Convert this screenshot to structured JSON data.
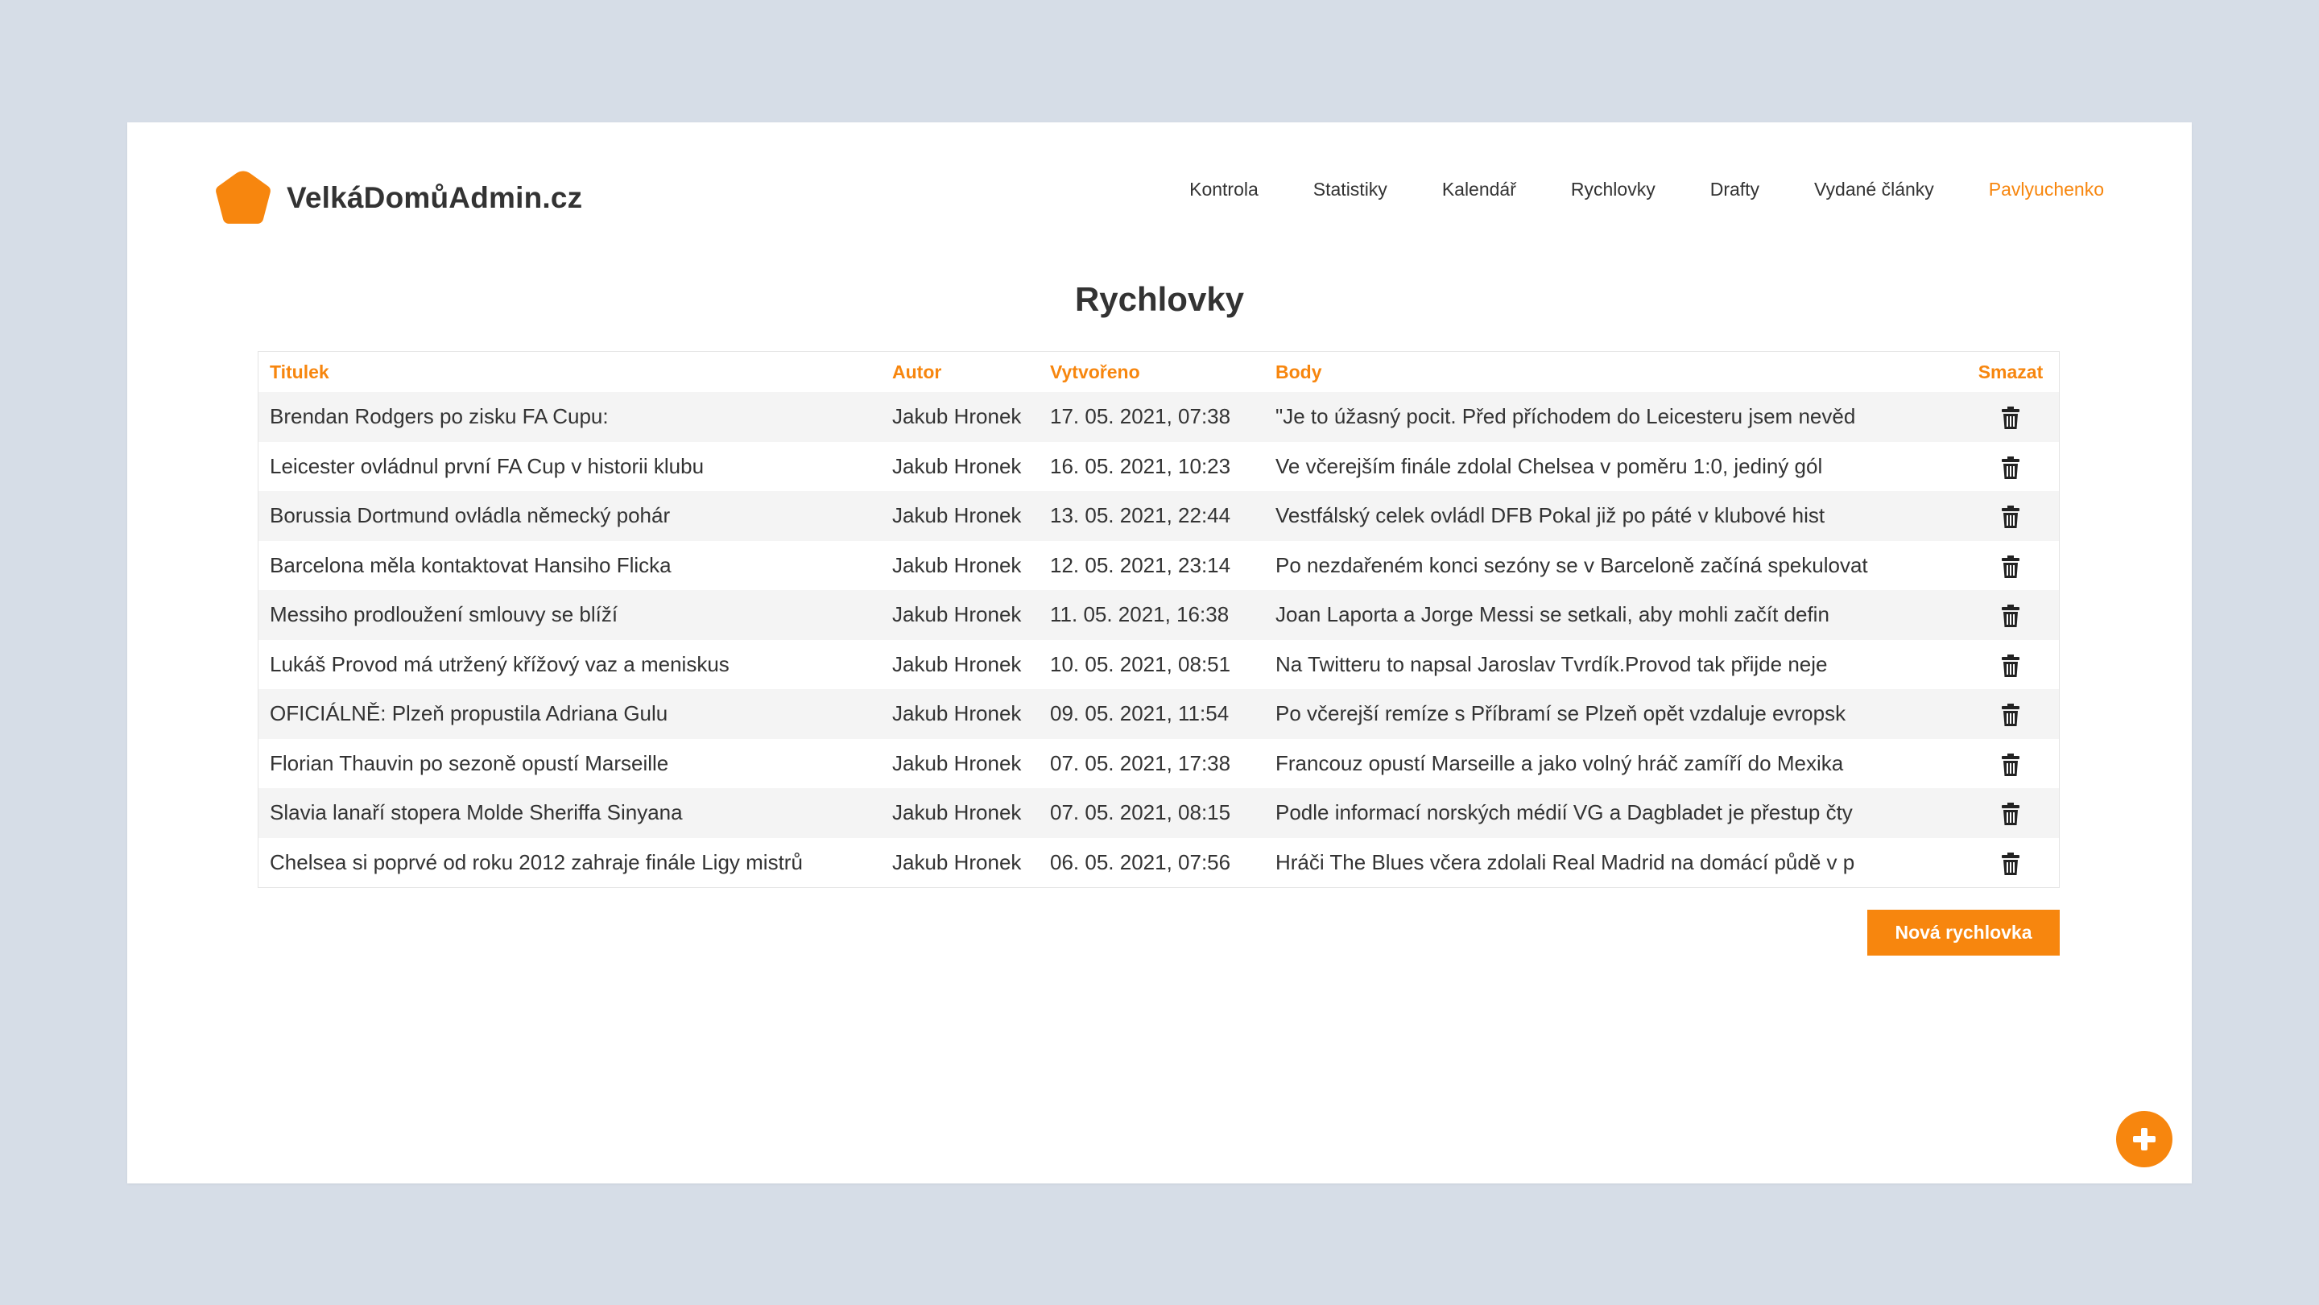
{
  "brand": {
    "name": "VelkáDomůAdmin.cz",
    "color": "#f7860e"
  },
  "nav": {
    "items": [
      {
        "label": "Kontrola"
      },
      {
        "label": "Statistiky"
      },
      {
        "label": "Kalendář"
      },
      {
        "label": "Rychlovky"
      },
      {
        "label": "Drafty"
      },
      {
        "label": "Vydané články"
      },
      {
        "label": "Pavlyuchenko"
      }
    ],
    "active_index": 6
  },
  "page": {
    "title": "Rychlovky"
  },
  "table": {
    "headers": {
      "title": "Titulek",
      "author": "Autor",
      "created": "Vytvořeno",
      "body": "Body",
      "delete": "Smazat"
    },
    "rows": [
      {
        "title": "Brendan Rodgers po zisku FA Cupu:",
        "author": "Jakub Hronek",
        "created": "17. 05. 2021, 07:38",
        "body": "\"Je to úžasný pocit. Před příchodem do Leicesteru jsem nevěd"
      },
      {
        "title": "Leicester ovládnul první FA Cup v historii klubu",
        "author": "Jakub Hronek",
        "created": "16. 05. 2021, 10:23",
        "body": "Ve včerejším finále zdolal Chelsea v poměru 1:0, jediný gól"
      },
      {
        "title": "Borussia Dortmund ovládla německý pohár",
        "author": "Jakub Hronek",
        "created": "13. 05. 2021, 22:44",
        "body": "Vestfálský celek ovládl DFB Pokal již po páté v klubové hist"
      },
      {
        "title": "Barcelona měla kontaktovat Hansiho Flicka",
        "author": "Jakub Hronek",
        "created": "12. 05. 2021, 23:14",
        "body": "Po nezdařeném konci sezóny se v Barceloně začíná spekulovat"
      },
      {
        "title": "Messiho prodloužení smlouvy se blíží",
        "author": "Jakub Hronek",
        "created": "11. 05. 2021, 16:38",
        "body": "Joan Laporta a Jorge Messi se setkali, aby mohli začít defin"
      },
      {
        "title": "Lukáš Provod má utržený křížový vaz a meniskus",
        "author": "Jakub Hronek",
        "created": "10. 05. 2021, 08:51",
        "body": "Na Twitteru to napsal Jaroslav Tvrdík.Provod tak přijde neje"
      },
      {
        "title": "OFICIÁLNĚ: Plzeň propustila Adriana Gulu",
        "author": "Jakub Hronek",
        "created": "09. 05. 2021, 11:54",
        "body": "Po včerejší remíze s Příbramí se Plzeň opět vzdaluje evropsk"
      },
      {
        "title": "Florian Thauvin po sezoně opustí Marseille",
        "author": "Jakub Hronek",
        "created": "07. 05. 2021, 17:38",
        "body": "Francouz opustí Marseille a jako volný hráč zamíří do Mexika"
      },
      {
        "title": "Slavia lanaří stopera Molde Sheriffa Sinyana",
        "author": "Jakub Hronek",
        "created": "07. 05. 2021, 08:15",
        "body": "Podle informací norských médií VG a Dagbladet je přestup čty"
      },
      {
        "title": "Chelsea si poprvé od roku 2012 zahraje finále Ligy mistrů",
        "author": "Jakub Hronek",
        "created": "06. 05. 2021, 07:56",
        "body": "Hráči The Blues včera zdolali Real Madrid na domácí půdě v p"
      }
    ],
    "delete_icon": "trash-icon"
  },
  "actions": {
    "new_label": "Nová rychlovka",
    "fab_icon": "plus-icon"
  }
}
